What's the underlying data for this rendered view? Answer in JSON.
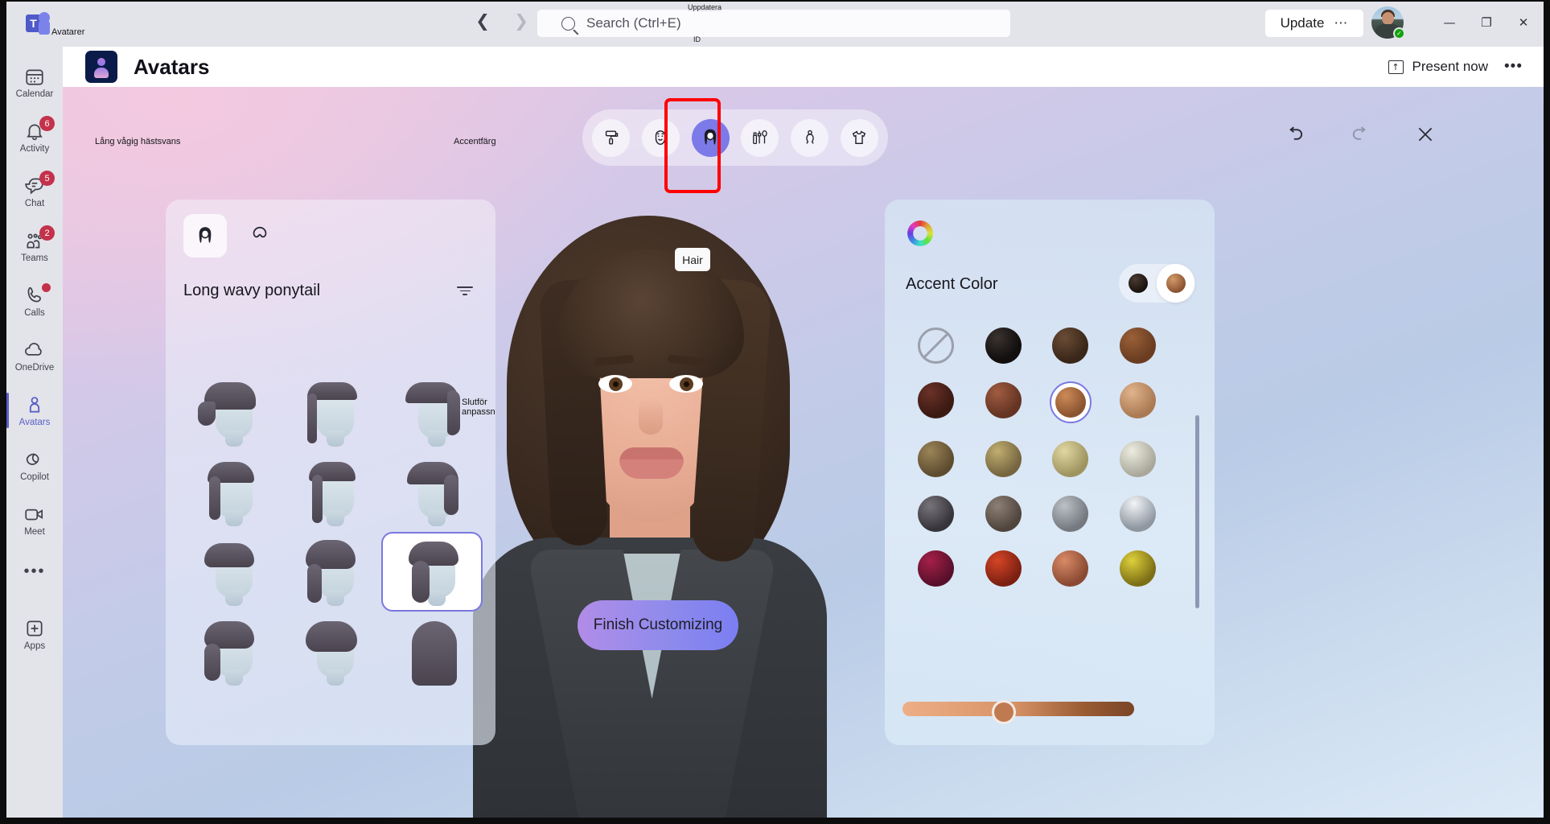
{
  "window": {
    "app_logo": "teams-logo",
    "tab_overlay_label": "Avatarer",
    "back_icon": "chevron-left-icon",
    "forward_icon": "chevron-right-icon",
    "search_placeholder": "Search (Ctrl+E)",
    "search_icon": "search-icon",
    "update_overlay_label": "Uppdatera",
    "id_overlay_label": "ID",
    "update_label": "Update",
    "update_more_icon": "ellipsis-icon",
    "presence_icon": "available-check-icon",
    "minimize_icon": "minimize-icon",
    "maximize_icon": "restore-icon",
    "close_icon": "close-icon",
    "minimize_glyph": "—",
    "maximize_glyph": "❐",
    "close_glyph": "✕"
  },
  "rail": {
    "items": [
      {
        "label": "Calendar",
        "icon": "calendar-icon",
        "badge": "",
        "active": false
      },
      {
        "label": "Activity",
        "icon": "bell-icon",
        "badge": "6",
        "active": false
      },
      {
        "label": "Chat",
        "icon": "chat-icon",
        "badge": "5",
        "active": false
      },
      {
        "label": "Teams",
        "icon": "teams-people-icon",
        "badge": "2",
        "active": false
      },
      {
        "label": "Calls",
        "icon": "phone-icon",
        "badge": "dot",
        "active": false
      },
      {
        "label": "OneDrive",
        "icon": "cloud-icon",
        "badge": "",
        "active": false
      },
      {
        "label": "Avatars",
        "icon": "person-icon",
        "badge": "",
        "active": true
      },
      {
        "label": "Copilot",
        "icon": "copilot-icon",
        "badge": "",
        "active": false
      },
      {
        "label": "Meet",
        "icon": "video-camera-icon",
        "badge": "",
        "active": false
      }
    ],
    "more_label": "•••",
    "apps_label": "Apps",
    "apps_icon": "plus-square-icon"
  },
  "header": {
    "app_icon": "avatars-app-icon",
    "title": "Avatars",
    "present_now_label": "Present now",
    "present_now_icon": "share-screen-icon",
    "more_icon": "ellipsis-icon",
    "more_label": "•••"
  },
  "stage": {
    "overlay_left": "Lång vågig hästsvans",
    "overlay_right": "Accentfärg",
    "overlay_grid": "Slutför anpassningen",
    "tabs": [
      {
        "name": "background",
        "icon": "paint-roller-icon",
        "selected": false
      },
      {
        "name": "face",
        "icon": "face-icon",
        "selected": false
      },
      {
        "name": "hair",
        "icon": "hair-icon",
        "selected": true
      },
      {
        "name": "makeup",
        "icon": "makeup-icon",
        "selected": false
      },
      {
        "name": "body",
        "icon": "body-icon",
        "selected": false
      },
      {
        "name": "clothing",
        "icon": "tshirt-icon",
        "selected": false
      }
    ],
    "selected_tab_tooltip": "Hair",
    "highlight_color": "#ff0000",
    "actions": [
      {
        "name": "undo",
        "icon": "undo-icon"
      },
      {
        "name": "redo",
        "icon": "redo-icon"
      },
      {
        "name": "close",
        "icon": "close-icon"
      }
    ],
    "finish_button_label": "Finish Customizing"
  },
  "left_panel": {
    "tabs": [
      {
        "name": "hairstyle",
        "icon": "hairstyle-icon",
        "selected": true
      },
      {
        "name": "facial-hair",
        "icon": "facial-hair-icon",
        "selected": false
      }
    ],
    "title": "Long wavy ponytail",
    "filter_icon": "filter-icon",
    "hairstyles": [
      {
        "id": 1,
        "name": "ponytail-low-tie",
        "selected": false
      },
      {
        "id": 2,
        "name": "side-braid",
        "selected": false
      },
      {
        "id": 3,
        "name": "long-side-part",
        "selected": false
      },
      {
        "id": 4,
        "name": "straight-ponytail",
        "selected": false
      },
      {
        "id": 5,
        "name": "long-straight-tail",
        "selected": false
      },
      {
        "id": 6,
        "name": "swept-long",
        "selected": false
      },
      {
        "id": 7,
        "name": "short-bob",
        "selected": false
      },
      {
        "id": 8,
        "name": "updo-wave",
        "selected": false
      },
      {
        "id": 9,
        "name": "long-wavy-ponytail",
        "selected": true
      },
      {
        "id": 10,
        "name": "braided-bun",
        "selected": false
      },
      {
        "id": 11,
        "name": "curly-short",
        "selected": false
      },
      {
        "id": 12,
        "name": "long-straight",
        "selected": false
      }
    ]
  },
  "right_panel": {
    "color_wheel_icon": "color-wheel-icon",
    "title": "Accent Color",
    "toggle": [
      {
        "name": "base-color",
        "color": "#231a14",
        "active": false
      },
      {
        "name": "accent-color",
        "color": "#a8693e",
        "active": true
      }
    ],
    "swatches": [
      {
        "name": "none",
        "color": "none",
        "selected": false
      },
      {
        "name": "black",
        "color": "#120f0e",
        "selected": false
      },
      {
        "name": "dark-brown",
        "color": "#4c3526",
        "selected": false
      },
      {
        "name": "brown",
        "color": "#7a4a2a",
        "selected": false
      },
      {
        "name": "deep-auburn",
        "color": "#4c241c",
        "selected": false
      },
      {
        "name": "auburn",
        "color": "#7d4430",
        "selected": false
      },
      {
        "name": "medium-brown",
        "color": "#a8663b",
        "selected": true
      },
      {
        "name": "light-brown",
        "color": "#c89a73",
        "selected": false
      },
      {
        "name": "dark-blonde",
        "color": "#7c6a45",
        "selected": false
      },
      {
        "name": "blonde",
        "color": "#9c8c55",
        "selected": false
      },
      {
        "name": "light-blonde",
        "color": "#c6bb85",
        "selected": false
      },
      {
        "name": "platinum",
        "color": "#c3c3bb",
        "selected": false
      },
      {
        "name": "dark-grey",
        "color": "#4e4e50",
        "selected": false
      },
      {
        "name": "grey-brown",
        "color": "#6d6257",
        "selected": false
      },
      {
        "name": "grey",
        "color": "#8e949a",
        "selected": false
      },
      {
        "name": "silver",
        "color": "#b9bfc6",
        "selected": false
      },
      {
        "name": "burgundy",
        "color": "#7d1437",
        "selected": false
      },
      {
        "name": "red",
        "color": "#b1301c",
        "selected": false
      },
      {
        "name": "copper",
        "color": "#b96a4c",
        "selected": false
      },
      {
        "name": "gold",
        "color": "#b5a229",
        "selected": false
      }
    ],
    "slider": {
      "name": "shade-slider",
      "gradient_from": "#eeae86",
      "gradient_to": "#7a4426",
      "value_percent": 47,
      "knob_color": "#c07a50"
    }
  }
}
